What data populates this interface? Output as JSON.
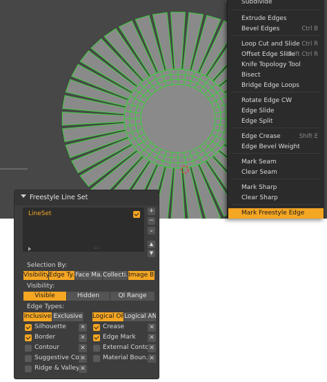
{
  "menu": {
    "items": [
      {
        "label": "Subdivide",
        "shortcut": ""
      },
      {
        "label": "Extrude Edges",
        "shortcut": ""
      },
      {
        "label": "Bevel Edges",
        "shortcut": "Ctrl B"
      },
      {
        "label": "Loop Cut and Slide",
        "shortcut": "Ctrl R"
      },
      {
        "label": "Offset Edge Slide",
        "shortcut": "Shift Ctrl R"
      },
      {
        "label": "Knife Topology Tool",
        "shortcut": ""
      },
      {
        "label": "Bisect",
        "shortcut": ""
      },
      {
        "label": "Bridge Edge Loops",
        "shortcut": ""
      },
      {
        "label": "Rotate Edge CW",
        "shortcut": ""
      },
      {
        "label": "Edge Slide",
        "shortcut": ""
      },
      {
        "label": "Edge Split",
        "shortcut": ""
      },
      {
        "label": "Edge Crease",
        "shortcut": "Shift E"
      },
      {
        "label": "Edge Bevel Weight",
        "shortcut": ""
      },
      {
        "label": "Mark Seam",
        "shortcut": ""
      },
      {
        "label": "Clear Seam",
        "shortcut": ""
      },
      {
        "label": "Mark Sharp",
        "shortcut": ""
      },
      {
        "label": "Clear Sharp",
        "shortcut": ""
      },
      {
        "label": "Mark Freestyle Edge",
        "shortcut": ""
      }
    ]
  },
  "panel": {
    "title": "Freestyle Line Set",
    "lineset_name": "LineSet",
    "list_add": "+",
    "list_remove": "−",
    "list_menu": "⌄",
    "list_up": "▲",
    "list_down": "▼",
    "list_resize": "::::",
    "selection_by_label": "Selection By:",
    "selection_buttons": [
      {
        "label": "Visibility",
        "on": true
      },
      {
        "label": "Edge Ty...",
        "on": true
      },
      {
        "label": "Face Ma...",
        "on": false
      },
      {
        "label": "Collecti...",
        "on": false
      },
      {
        "label": "Image B...",
        "on": true
      }
    ],
    "visibility_label": "Visibility:",
    "visibility_options": [
      {
        "label": "Visible",
        "on": true
      },
      {
        "label": "Hidden",
        "on": false
      },
      {
        "label": "QI Range",
        "on": false
      }
    ],
    "edge_types_label": "Edge Types:",
    "inclusion_options": [
      {
        "label": "Inclusive",
        "on": true
      },
      {
        "label": "Exclusive",
        "on": false
      }
    ],
    "logic_options": [
      {
        "label": "Logical OR",
        "on": true
      },
      {
        "label": "Logical AND",
        "on": false
      }
    ],
    "edge_types_left": [
      {
        "label": "Silhouette",
        "on": true
      },
      {
        "label": "Border",
        "on": true
      },
      {
        "label": "Contour",
        "on": false
      },
      {
        "label": "Suggestive Co...",
        "on": false
      },
      {
        "label": "Ridge & Valley",
        "on": false
      }
    ],
    "edge_types_right": [
      {
        "label": "Crease",
        "on": true
      },
      {
        "label": "Edge Mark",
        "on": true
      },
      {
        "label": "External Conto...",
        "on": false
      },
      {
        "label": "Material Boun...",
        "on": false
      }
    ],
    "exclude_glyph": "✕"
  },
  "colors": {
    "viewport_bg": "#474747",
    "mesh_face": "#8a8a8a",
    "mesh_edge": "#3bd13b",
    "accent": "#f5a623"
  },
  "icons": {
    "expand": "triangle-down-icon",
    "check": "checkmark-icon",
    "exclude": "x-icon",
    "add": "plus-icon",
    "remove": "minus-icon"
  }
}
